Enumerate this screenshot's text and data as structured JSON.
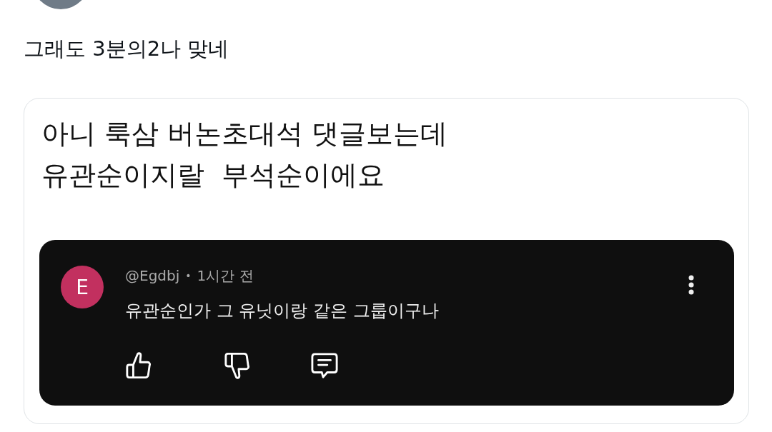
{
  "post": {
    "text": "그래도 3분의2나 맞네"
  },
  "attached_image": {
    "caption": "아니 룩삼 버논초대석 댓글보는데\n유관순이지랄  부석순이에요",
    "comment": {
      "avatar_initial": "E",
      "author": "@Egdbj",
      "separator": "•",
      "time": "1시간 전",
      "text": "유관순인가 그 유닛이랑 같은 그룹이구나"
    }
  }
}
